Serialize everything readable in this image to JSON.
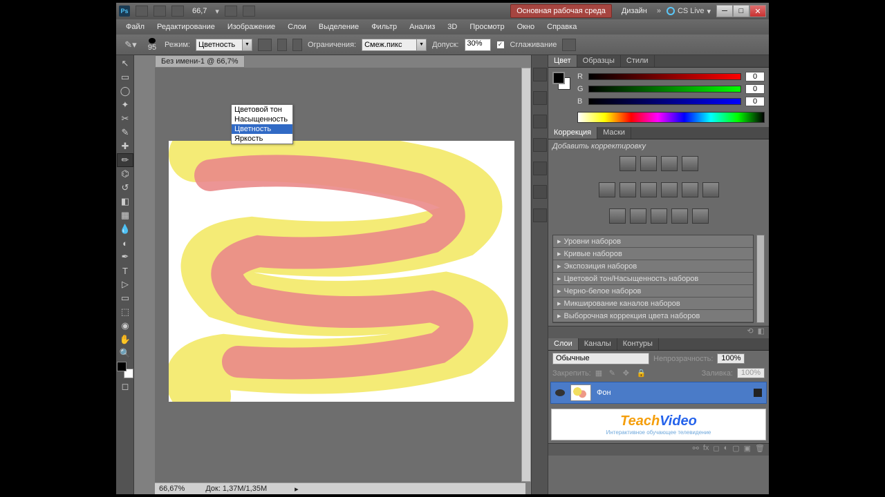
{
  "titlebar": {
    "zoom": "66,7",
    "workspace": "Основная рабочая среда",
    "design": "Дизайн",
    "cslive": "CS Live"
  },
  "menu": [
    "Файл",
    "Редактирование",
    "Изображение",
    "Слои",
    "Выделение",
    "Фильтр",
    "Анализ",
    "3D",
    "Просмотр",
    "Окно",
    "Справка"
  ],
  "options": {
    "brush_size": "95",
    "mode_label": "Режим:",
    "mode_value": "Цветность",
    "limits_label": "Ограничения:",
    "limits_value": "Смеж.пикс",
    "tolerance_label": "Допуск:",
    "tolerance_value": "30%",
    "antialias": "Сглаживание"
  },
  "dropdown": {
    "items": [
      "Цветовой тон",
      "Насыщенность",
      "Цветность",
      "Яркость"
    ],
    "highlight": 2
  },
  "document": {
    "tab": "Без имени-1 @ 66,7%"
  },
  "statusbar": {
    "zoom": "66,67%",
    "doc": "Док: 1,37M/1,35M"
  },
  "panels": {
    "color_tabs": [
      "Цвет",
      "Образцы",
      "Стили"
    ],
    "rgb": [
      {
        "l": "R",
        "v": "0"
      },
      {
        "l": "G",
        "v": "0"
      },
      {
        "l": "B",
        "v": "0"
      }
    ],
    "adj_tabs": [
      "Коррекция",
      "Маски"
    ],
    "adj_label": "Добавить корректировку",
    "presets": [
      "Уровни наборов",
      "Кривые наборов",
      "Экспозиция наборов",
      "Цветовой тон/Насыщенность наборов",
      "Черно-белое наборов",
      "Микширование каналов наборов",
      "Выборочная коррекция цвета наборов"
    ],
    "layer_tabs": [
      "Слои",
      "Каналы",
      "Контуры"
    ],
    "blend": "Обычные",
    "opacity_l": "Непрозрачность:",
    "opacity_v": "100%",
    "lock_l": "Закрепить:",
    "fill_l": "Заливка:",
    "fill_v": "100%",
    "layer_name": "Фон"
  },
  "teachvideo": {
    "t1": "Teach",
    "t2": "Video",
    "sub": "Интерактивное обучающее телевидение"
  }
}
